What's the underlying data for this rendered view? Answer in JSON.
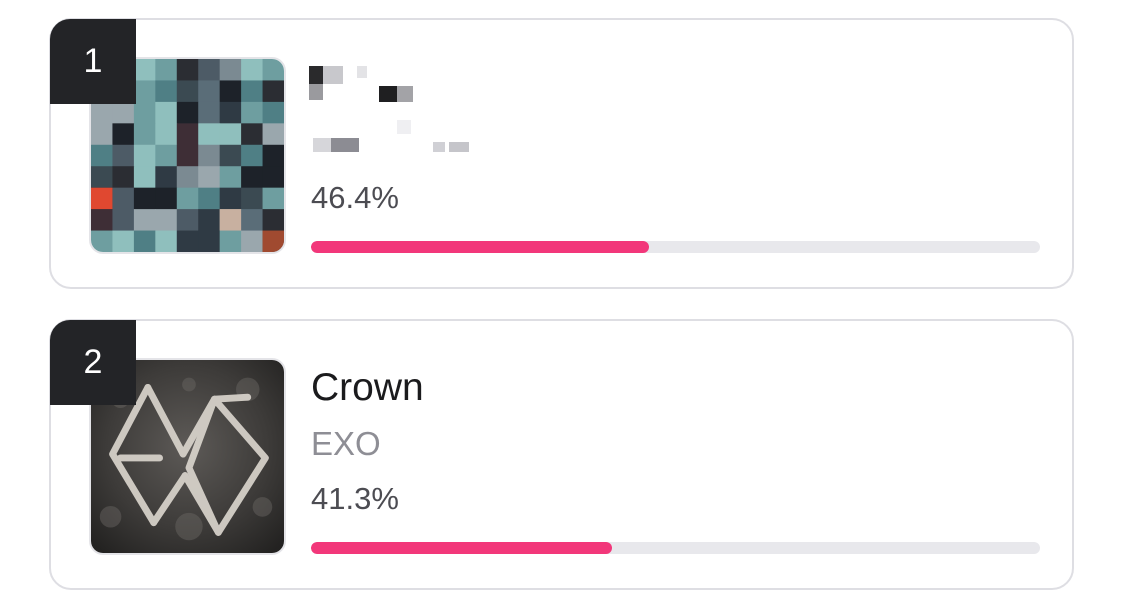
{
  "entries": [
    {
      "rank": "1",
      "title": "",
      "artist": "",
      "percent_label": "46.4%",
      "share": 0.464,
      "art_icon": "album-cover-pixelated-icon"
    },
    {
      "rank": "2",
      "title": "Crown",
      "artist": "EXO",
      "percent_label": "41.3%",
      "share": 0.413,
      "art_icon": "album-cover-exo-logo-icon"
    }
  ],
  "colors": {
    "bar_fill": "#f2377a",
    "bar_track": "#e8e8ec",
    "rank_badge": "#232427",
    "card_border": "#dedee3"
  }
}
